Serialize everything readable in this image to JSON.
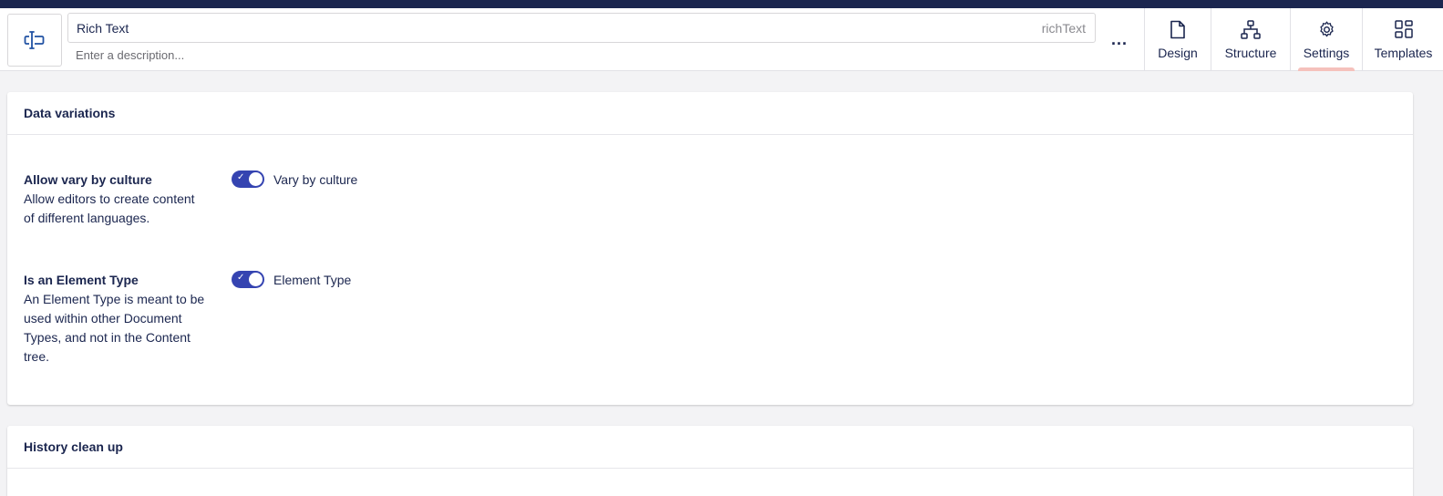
{
  "header": {
    "name_value": "Rich Text",
    "alias": "richText",
    "description_placeholder": "Enter a description...",
    "more_label": "..."
  },
  "tabs": [
    {
      "label": "Design",
      "icon": "document-icon"
    },
    {
      "label": "Structure",
      "icon": "sitemap-icon"
    },
    {
      "label": "Settings",
      "icon": "gear-icon",
      "active": true
    },
    {
      "label": "Templates",
      "icon": "grid-icon"
    }
  ],
  "data_variations": {
    "title": "Data variations",
    "vary_by_culture": {
      "title": "Allow vary by culture",
      "description": "Allow editors to create content of different languages.",
      "toggle_label": "Vary by culture",
      "checked": true
    },
    "element_type": {
      "title": "Is an Element Type",
      "description": "An Element Type is meant to be used within other Document Types, and not in the Content tree.",
      "toggle_label": "Element Type",
      "checked": true
    }
  },
  "history_cleanup": {
    "title": "History clean up"
  },
  "colors": {
    "topbar": "#1b264f",
    "toggle_on": "#3544b1",
    "active_tab_indicator": "#f5c1bc",
    "icon_accent": "#2152a3"
  }
}
